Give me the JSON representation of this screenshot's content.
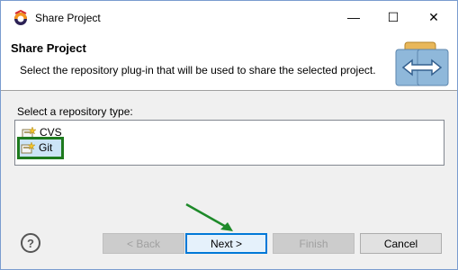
{
  "window": {
    "title": "Share Project",
    "controls": {
      "minimize": "—",
      "maximize": "☐",
      "close": "✕"
    }
  },
  "header": {
    "title": "Share Project",
    "description": "Select the repository plug-in that will be used to share the selected project."
  },
  "repository": {
    "label": "Select a repository type:",
    "items": [
      {
        "label": "CVS",
        "selected": false
      },
      {
        "label": "Git",
        "selected": true
      }
    ]
  },
  "footer": {
    "help": "?",
    "back_label": "< Back",
    "next_label": "Next >",
    "finish_label": "Finish",
    "cancel_label": "Cancel"
  },
  "colors": {
    "highlight_border": "#1e7a1e",
    "arrow": "#1e8a2a",
    "primary_button_border": "#0078d7"
  }
}
